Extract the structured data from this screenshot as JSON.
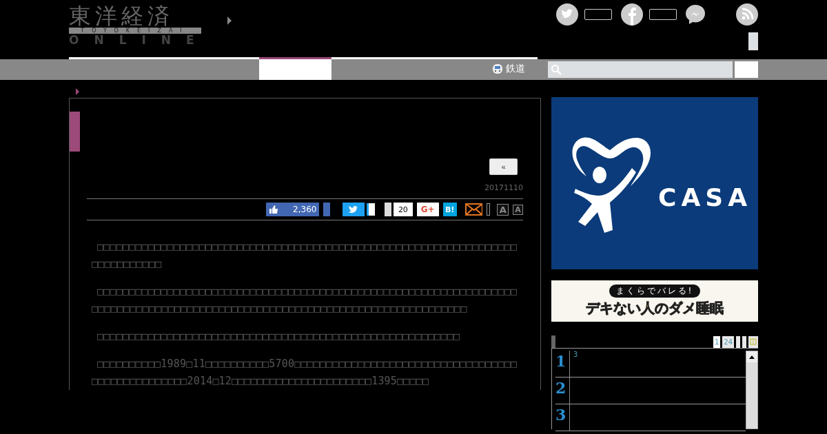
{
  "logo": {
    "title": "東洋経済",
    "subtitle": "TOYOKEIZAI",
    "tagline": "ONLINE"
  },
  "header_social": [
    {
      "kind": "twitter"
    },
    {
      "kind": "count"
    },
    {
      "kind": "facebook"
    },
    {
      "kind": "count"
    },
    {
      "kind": "messenger"
    },
    {
      "kind": "rss"
    }
  ],
  "nav": {
    "tabs": [
      {
        "selected": false
      },
      {
        "selected": true
      },
      {
        "selected": false
      }
    ],
    "link": "鉄道"
  },
  "article": {
    "back": "«",
    "date": "20171110",
    "share": [
      {
        "kind": "like",
        "count": "2,360"
      },
      {
        "kind": "block"
      },
      {
        "kind": "twitter"
      },
      {
        "kind": "bubble"
      },
      {
        "kind": "gray"
      },
      {
        "kind": "count",
        "count": "20"
      },
      {
        "kind": "gplus",
        "label": "G+"
      },
      {
        "kind": "hatena",
        "label": "B!"
      },
      {
        "kind": "mail"
      },
      {
        "kind": "empty"
      },
      {
        "kind": "font-large",
        "label": "A"
      },
      {
        "kind": "font-small",
        "label": "A"
      }
    ],
    "paragraphs": [
      "□□□□□□□□□□□□□□□□□□□□□□□□□□□□□□□□□□□□□□□□□□□□□□□□□□□□□□□□□□□□□□□□□□□□□□□□□□□□□",
      "□□□□□□□□□□□□□□□□□□□□□□□□□□□□□□□□□□□□□□□□□□□□□□□□□□□□□□□□□□□□□□□□□□□□□□□□□□□□□□□□□□□□□□□□□□□□□□□□□□□□□□□□□□□□□□□□□□□□□□□□□□□□□",
      "□□□□□□□□□□□□□□□□□□□□□□□□□□□□□□□□□□□□□□□□□□□□□□□□□□□□□□□□□",
      "□□□□□□□□□□1989□11□□□□□□□□□□5700□□□□□□□□□□□□□□□□□□□□□□□□□□□□□□□□□□□□□□□□□□□□□□□□□□2014□12□□□□□□□□□□□□□□□□□□□□□□1395□□□□□"
    ]
  },
  "ads": [
    {
      "kind": "casa",
      "brand": "CASA"
    },
    {
      "kind": "sleep",
      "kicker": "まくらでバレる!",
      "headline": "デキない人のダメ睡眠"
    }
  ],
  "ranking": {
    "tabs": [
      {
        "label": "1",
        "selected": true
      },
      {
        "label": "24",
        "selected": false
      },
      {
        "selected": false
      },
      {
        "selected": false
      },
      {
        "kind": "icon",
        "selected": false
      }
    ],
    "rows": [
      {
        "rank": "1",
        "text": "3"
      },
      {
        "rank": "2"
      },
      {
        "rank": "3"
      }
    ]
  }
}
